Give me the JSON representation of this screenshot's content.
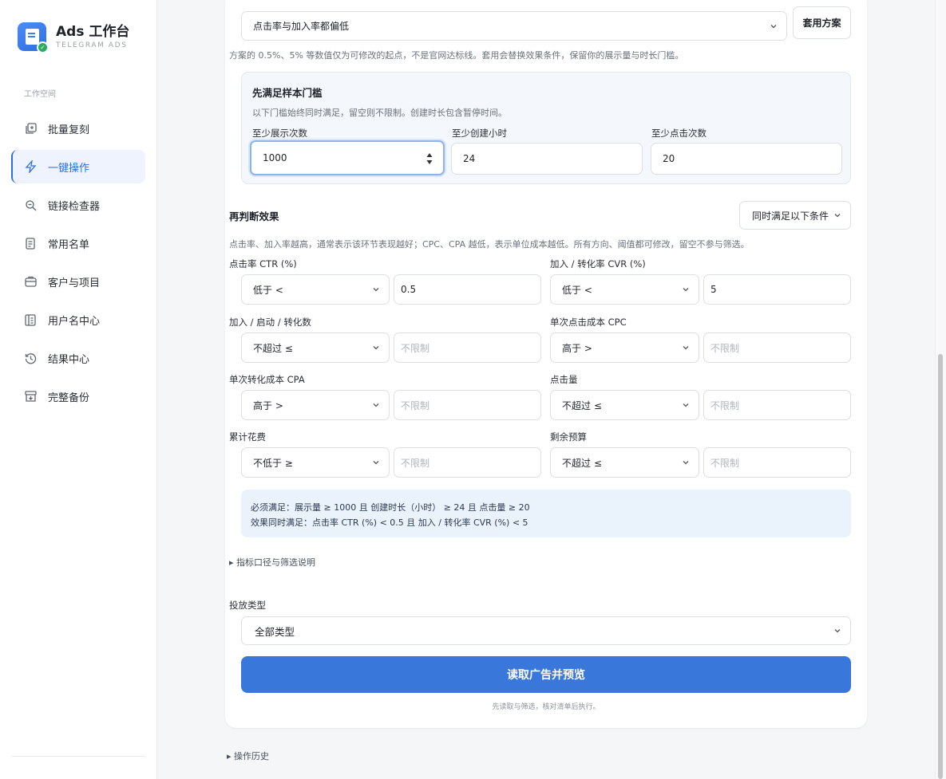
{
  "brand": {
    "title": "Ads 工作台",
    "subtitle": "TELEGRAM ADS"
  },
  "sidebar": {
    "section_label": "工作空间",
    "items": [
      {
        "label": "批量复刻",
        "icon": "copy-plus-icon",
        "active": false
      },
      {
        "label": "一键操作",
        "icon": "lightning-icon",
        "active": true
      },
      {
        "label": "链接检查器",
        "icon": "search-link-icon",
        "active": false
      },
      {
        "label": "常用名单",
        "icon": "list-doc-icon",
        "active": false
      },
      {
        "label": "客户与项目",
        "icon": "briefcase-icon",
        "active": false
      },
      {
        "label": "用户名中心",
        "icon": "username-card-icon",
        "active": false
      },
      {
        "label": "结果中心",
        "icon": "history-clock-icon",
        "active": false
      },
      {
        "label": "完整备份",
        "icon": "archive-box-icon",
        "active": false
      }
    ]
  },
  "preset": {
    "selected": "点击率与加入率都偏低",
    "apply_label": "套用方案",
    "hint": "方案的 0.5%、5% 等数值仅为可修改的起点，不是官网达标线。套用会替换效果条件，保留你的展示量与时长门槛。"
  },
  "threshold": {
    "title": "先满足样本门槛",
    "hint": "以下门槛始终同时满足，留空则不限制。创建时长包含暂停时间。",
    "fields": [
      {
        "label": "至少展示次数",
        "value": "1000"
      },
      {
        "label": "至少创建小时",
        "value": "24"
      },
      {
        "label": "至少点击次数",
        "value": "20"
      }
    ]
  },
  "effect": {
    "title": "再判断效果",
    "mode": "同时满足以下条件",
    "hint": "点击率、加入率越高，通常表示该环节表现越好；CPC、CPA 越低，表示单位成本越低。所有方向、阈值都可修改，留空不参与筛选。",
    "placeholder": "不限制",
    "conditions": [
      {
        "label": "点击率 CTR (%)",
        "op": "低于 <",
        "value": "0.5"
      },
      {
        "label": "加入 / 转化率 CVR (%)",
        "op": "低于 <",
        "value": "5"
      },
      {
        "label": "加入 / 启动 / 转化数",
        "op": "不超过 ≤",
        "value": ""
      },
      {
        "label": "单次点击成本 CPC",
        "op": "高于 >",
        "value": ""
      },
      {
        "label": "单次转化成本 CPA",
        "op": "高于 >",
        "value": ""
      },
      {
        "label": "点击量",
        "op": "不超过 ≤",
        "value": ""
      },
      {
        "label": "累计花费",
        "op": "不低于 ≥",
        "value": ""
      },
      {
        "label": "剩余预算",
        "op": "不超过 ≤",
        "value": ""
      }
    ]
  },
  "summary": {
    "line1": "必须满足：展示量 ≥ 1000 且 创建时长（小时） ≥ 24 且 点击量 ≥ 20",
    "line2": "效果同时满足：点击率 CTR (%) < 0.5 且 加入 / 转化率 CVR (%) < 5"
  },
  "details_label": "▸ 指标口径与筛选说明",
  "delivery": {
    "label": "投放类型",
    "selected": "全部类型"
  },
  "primary_button": "读取广告并预览",
  "footer_hint": "先读取与筛选，核对清单后执行。",
  "history_label": "▸ 操作历史",
  "colors": {
    "accent": "#3977db",
    "active_bg": "#eef3fd",
    "summary_bg": "#eaf2fc"
  }
}
